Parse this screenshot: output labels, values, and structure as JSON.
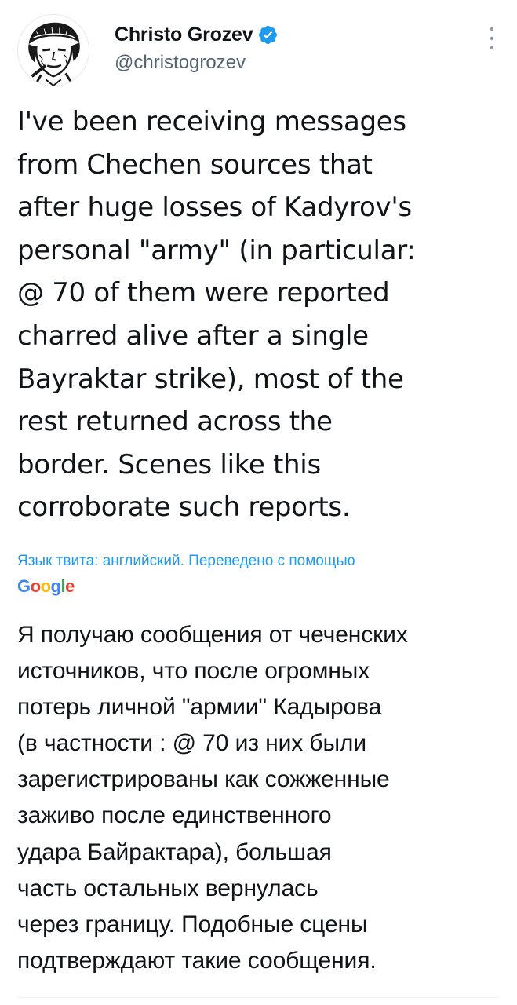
{
  "author": {
    "display_name": "Christo Grozev",
    "handle": "@christogrozev",
    "verified": true,
    "avatar_icon": "avatar-sketch-portrait",
    "verified_icon": "verified-badge-icon",
    "more_icon": "more-vertical-icon"
  },
  "tweet": {
    "text": "I've been receiving messages\nfrom Chechen sources that\nafter huge losses of Kadyrov's\npersonal \"army\" (in particular:\n@ 70 of them were reported\ncharred alive after a single\nBayraktar strike), most of the\nrest returned across the\nborder. Scenes like this\ncorroborate such reports."
  },
  "translation": {
    "note": "Язык твита: английский. Переведено с помощью",
    "provider": "Google",
    "text": "Я получаю сообщения от чеченских\nисточников, что после огромных\nпотерь личной \"армии\" Кадырова\n(в частности : @ 70 из них были\nзарегистрированы как сожженные\nзаживо после единственного\nудара Байрактара), большая\nчасть остальных вернулась\nчерез границу. Подобные сцены\nподтверждают такие сообщения."
  },
  "colors": {
    "link_blue": "#1d9bf0",
    "secondary_text": "#536471",
    "primary_text": "#0f1419",
    "google_blue": "#4285f4",
    "google_red": "#ea4335",
    "google_yellow": "#fbbc05",
    "google_green": "#34a853"
  }
}
